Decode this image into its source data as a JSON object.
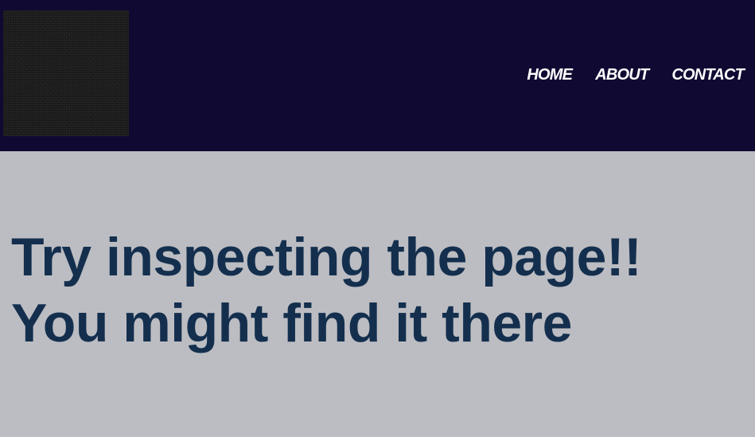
{
  "header": {
    "nav": {
      "home": "HOME",
      "about": "ABOUT",
      "contact": "CONTACT"
    }
  },
  "main": {
    "heading": "Try inspecting the page!! You might find it there"
  },
  "colors": {
    "header_bg": "#100a33",
    "page_bg": "#bcbdc2",
    "heading_text": "#142f4e",
    "nav_text": "#ffffff"
  }
}
